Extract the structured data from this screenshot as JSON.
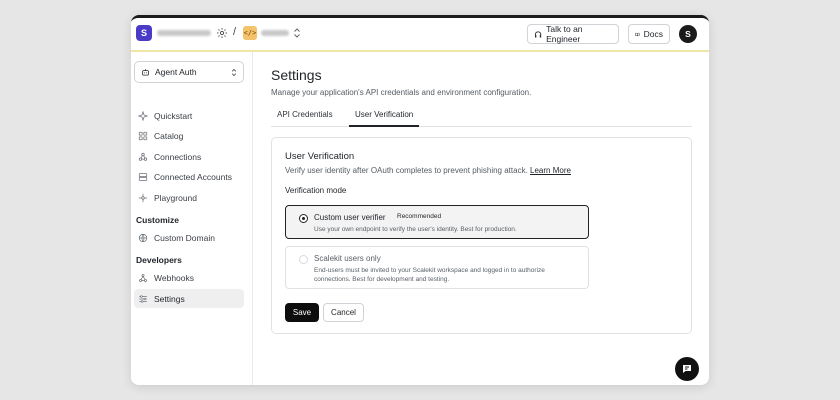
{
  "topbar": {
    "workspace_initial": "S",
    "separator": "/",
    "project_icon": "</>",
    "talk_label": "Talk to an Engineer",
    "docs_label": "Docs",
    "user_initial": "S"
  },
  "sidebar": {
    "app_selector": "Agent Auth",
    "items": [
      {
        "label": "Quickstart",
        "icon": "sparkle-icon"
      },
      {
        "label": "Catalog",
        "icon": "grid-icon"
      },
      {
        "label": "Connections",
        "icon": "connections-icon"
      },
      {
        "label": "Connected Accounts",
        "icon": "accounts-icon"
      },
      {
        "label": "Playground",
        "icon": "playground-icon"
      }
    ],
    "customize_label": "Customize",
    "customize_items": [
      {
        "label": "Custom Domain",
        "icon": "globe-icon"
      }
    ],
    "developers_label": "Developers",
    "developer_items": [
      {
        "label": "Webhooks",
        "icon": "webhook-icon"
      },
      {
        "label": "Settings",
        "icon": "settings-icon",
        "active": true
      }
    ]
  },
  "main": {
    "title": "Settings",
    "subtitle": "Manage your application's API credentials and environment configuration.",
    "tabs": [
      {
        "label": "API Credentials",
        "active": false
      },
      {
        "label": "User Verification",
        "active": true
      }
    ],
    "card": {
      "title": "User Verification",
      "description": "Verify user identity after OAuth completes to prevent phishing attack.",
      "learn_more": "Learn More",
      "mode_label": "Verification mode",
      "options": [
        {
          "title": "Custom user verifier",
          "badge": "Recommended",
          "description": "Use your own endpoint to verify the user's identity. Best for production.",
          "selected": true
        },
        {
          "title": "Scalekit users only",
          "description": "End-users must be invited to your Scalekit workspace and logged in to authorize connections. Best for development and testing.",
          "selected": false
        }
      ],
      "save_label": "Save",
      "cancel_label": "Cancel"
    }
  }
}
